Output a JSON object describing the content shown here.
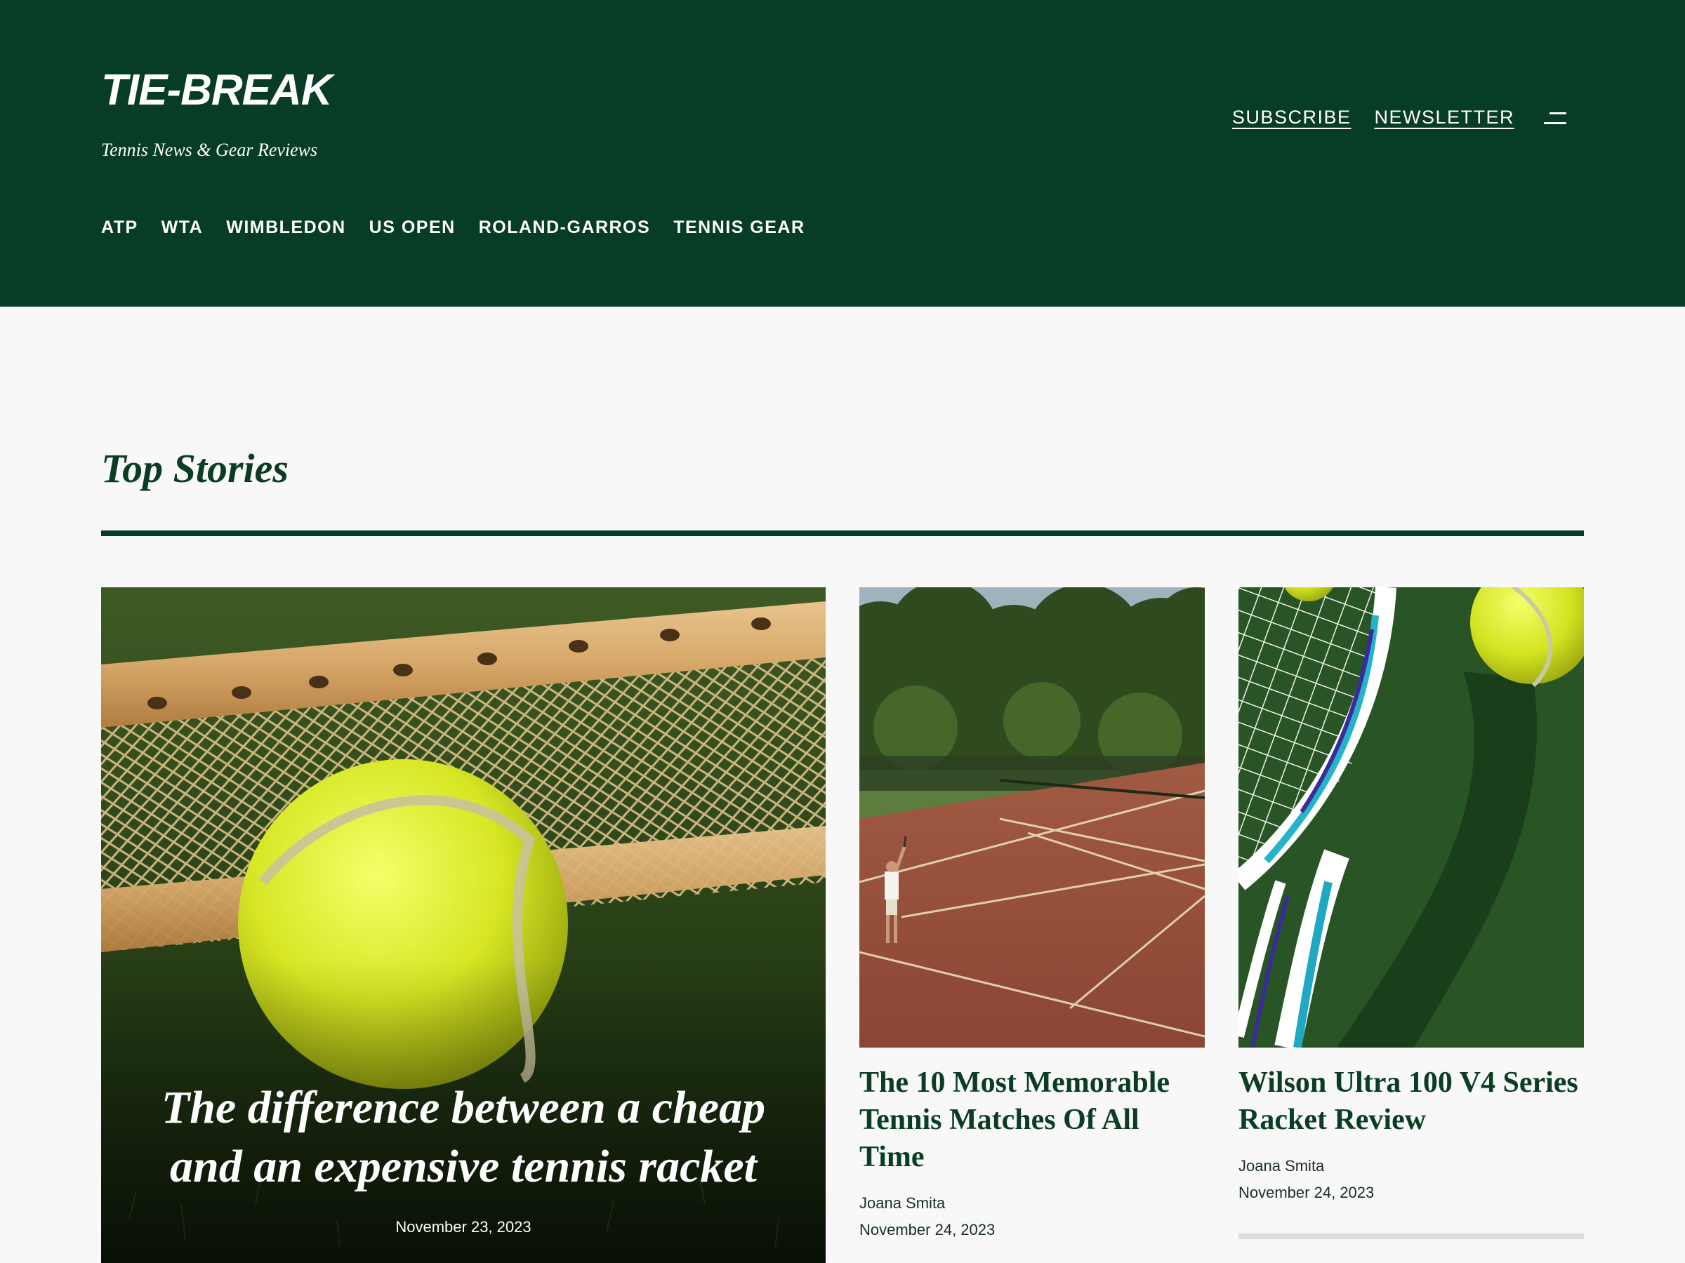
{
  "header": {
    "brand": "TIE-BREAK",
    "tagline": "Tennis News & Gear Reviews",
    "links": {
      "subscribe": "SUBSCRIBE",
      "newsletter": "NEWSLETTER"
    },
    "menu_icon": "hamburger-menu-icon",
    "nav": [
      "ATP",
      "WTA",
      "WIMBLEDON",
      "US OPEN",
      "ROLAND-GARROS",
      "TENNIS GEAR"
    ]
  },
  "section": {
    "title": "Top Stories"
  },
  "feature": {
    "title": "The difference between a cheap and an expensive tennis racket",
    "date": "November 23, 2023",
    "image": "tennis-ball-on-grass-with-wooden-racket"
  },
  "stories": [
    {
      "title": "The 10 Most Memorable Tennis Matches Of All Time",
      "author": "Joana Smita",
      "date": "November 24, 2023",
      "image": "clay-court-player-serving"
    },
    {
      "title": "Wilson Ultra 100 V4 Series Racket Review",
      "author": "Joana Smita",
      "date": "November 24, 2023",
      "image": "racket-and-balls-on-green-court"
    }
  ],
  "colors": {
    "brand_green": "#063d24",
    "page_background": "#f8f8f8",
    "heading_green": "#0b3d24"
  }
}
